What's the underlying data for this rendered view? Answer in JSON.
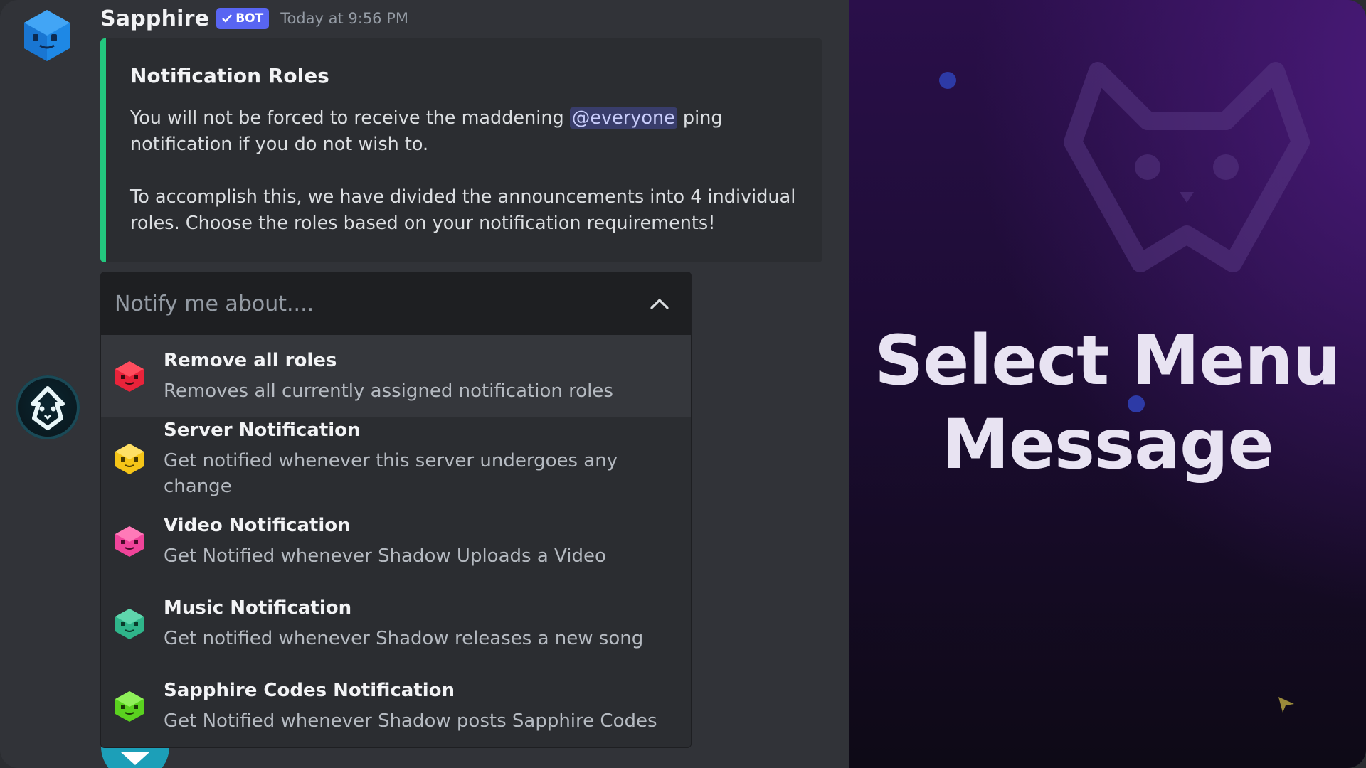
{
  "message": {
    "username": "Sapphire",
    "bot_badge": "BOT",
    "timestamp": "Today at 9:56 PM"
  },
  "embed": {
    "accent_color": "#23c77e",
    "title": "Notification Roles",
    "para1_before": "You will not be forced to receive the maddening ",
    "mention": "@everyone",
    "para1_after": " ping notification if you do not wish to.",
    "para2": "To accomplish this, we have divided the announcements into 4 individual roles. Choose the roles based on your notification requirements!"
  },
  "select_menu": {
    "placeholder": "Notify me about....",
    "expanded": true,
    "options": [
      {
        "label": "Remove all roles",
        "description": "Removes all currently assigned notification roles",
        "icon": "red-cube-icon",
        "color": "#e8233a"
      },
      {
        "label": "Server Notification",
        "description": "Get notified whenever this server undergoes any change",
        "icon": "yellow-cube-icon",
        "color": "#f5c518"
      },
      {
        "label": "Video Notification",
        "description": "Get Notified whenever Shadow Uploads a Video",
        "icon": "pink-cube-icon",
        "color": "#f0449a"
      },
      {
        "label": "Music Notification",
        "description": "Get notified whenever Shadow releases a new song",
        "icon": "teal-cube-icon",
        "color": "#2fb58a"
      },
      {
        "label": "Sapphire Codes Notification",
        "description": "Get Notified whenever Shadow posts Sapphire Codes",
        "icon": "green-cube-icon",
        "color": "#5ad11f"
      }
    ]
  },
  "panel": {
    "title_line1": "Select Menu",
    "title_line2": "Message"
  }
}
